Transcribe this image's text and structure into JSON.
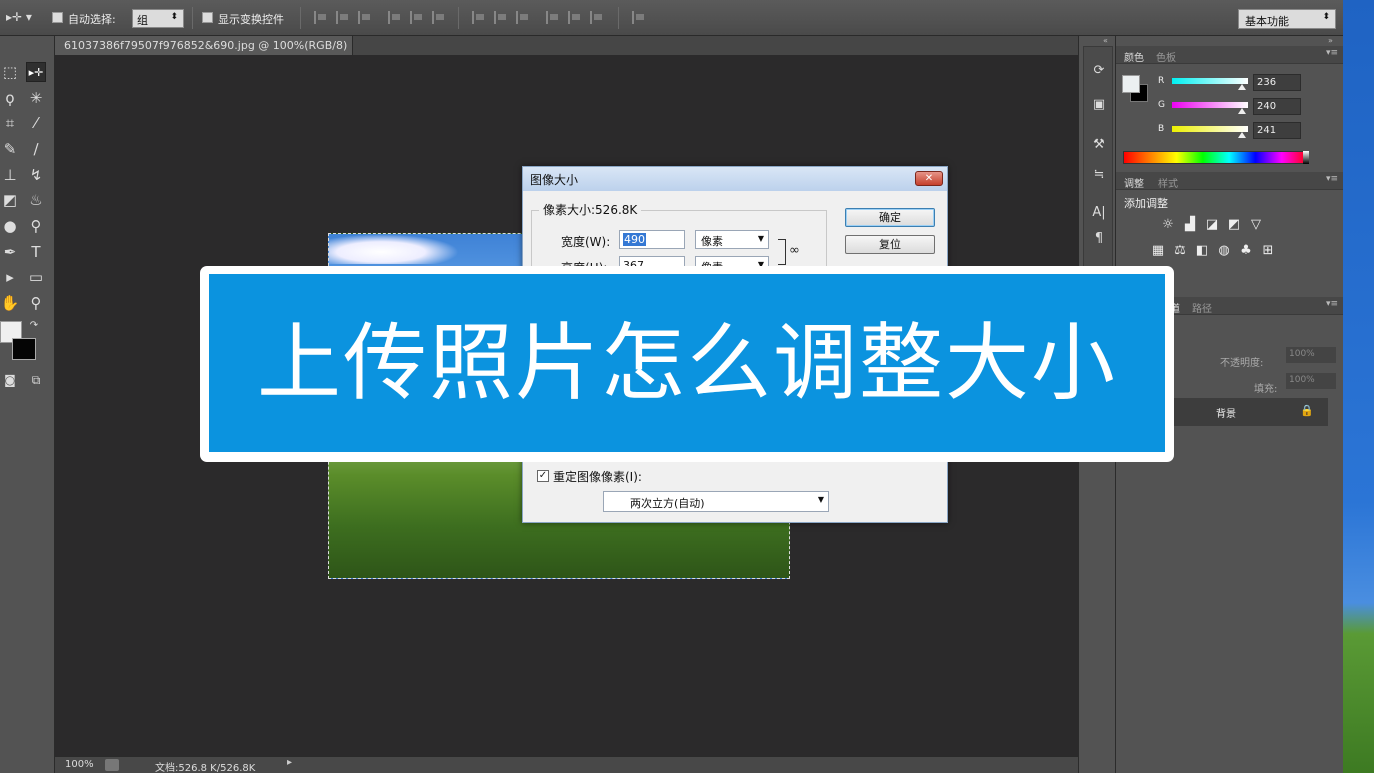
{
  "options_bar": {
    "tool_preset_icon": "move-tool-icon",
    "auto_select_label": "自动选择:",
    "auto_select_value": "组",
    "show_transform_label": "显示变换控件",
    "workspace_value": "基本功能"
  },
  "document": {
    "tab_title": "61037386f79507f976852&690.jpg @ 100%(RGB/8)",
    "tab_close": "×"
  },
  "status_bar": {
    "zoom": "100%",
    "doc_size": "文档:526.8 K/526.8K",
    "arrow": "▸"
  },
  "tools": {
    "fg_color": "#f0f0f0",
    "bg_color": "#050505"
  },
  "panels": {
    "color_tabs": [
      "颜色",
      "色板"
    ],
    "channels": [
      {
        "label": "R",
        "value": "236"
      },
      {
        "label": "G",
        "value": "240"
      },
      {
        "label": "B",
        "value": "241"
      }
    ],
    "adjust_tabs": [
      "调整",
      "样式"
    ],
    "add_adjustment": "添加调整",
    "layers_tabs": [
      "通道",
      "路径"
    ],
    "opacity_label": "不透明度:",
    "opacity_value": "100%",
    "fill_label": "填充:",
    "fill_value": "100%",
    "layer_name": "背景"
  },
  "dialog": {
    "title": "图像大小",
    "close": "✕",
    "pixel_size_label": "像素大小:526.8K",
    "width_label": "宽度(W):",
    "width_value": "490",
    "width_unit": "像素",
    "height_label": "高度(H):",
    "height_value": "367",
    "height_unit": "像素",
    "ok": "确定",
    "reset": "复位",
    "resample_label": "重定图像像素(I):",
    "resample_method": "两次立方(自动)"
  },
  "banner": {
    "text": "上传照片怎么调整大小"
  },
  "colors": {
    "banner_blue": "#0b93df",
    "canvas_bg": "#2b2a2b",
    "panel_bg": "#535353"
  }
}
